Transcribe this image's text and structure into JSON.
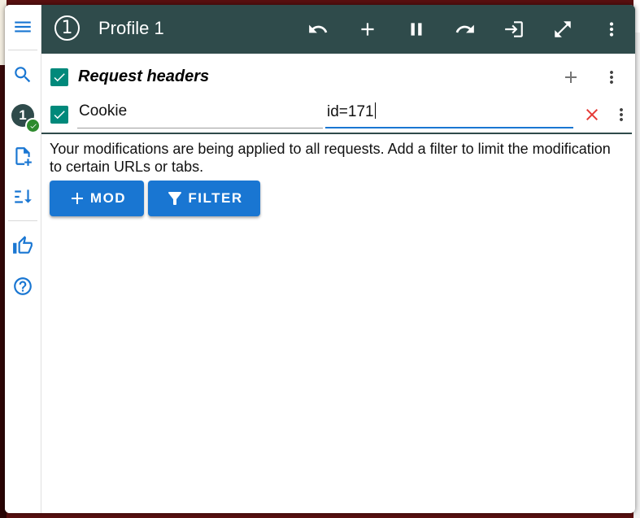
{
  "header": {
    "profile_number": "1",
    "title": "Profile 1",
    "actions": [
      {
        "icon": "undo-icon"
      },
      {
        "icon": "add-icon"
      },
      {
        "icon": "pause-icon"
      },
      {
        "icon": "redo-icon"
      },
      {
        "icon": "login-icon"
      },
      {
        "icon": "fullscreen-icon"
      },
      {
        "icon": "more-vert-icon"
      }
    ]
  },
  "sidebar": {
    "profile_badge": "1",
    "items": [
      "menu-icon",
      "search-icon",
      "profile-badge",
      "add-file-icon",
      "sort-icon",
      "thumb-up-icon",
      "help-icon"
    ]
  },
  "section": {
    "title": "Request headers",
    "enabled": true
  },
  "header_row": {
    "enabled": true,
    "name": "Cookie",
    "value": "id=171"
  },
  "info": {
    "text": "Your modifications are being applied to all requests. Add a filter to limit the modification to certain URLs or tabs."
  },
  "buttons": {
    "mod_label": "MOD",
    "filter_label": "FILTER"
  },
  "colors": {
    "header_bg": "#2f4b4b",
    "primary": "#1976d2",
    "checkbox": "#00897b",
    "delete": "#e53935"
  }
}
